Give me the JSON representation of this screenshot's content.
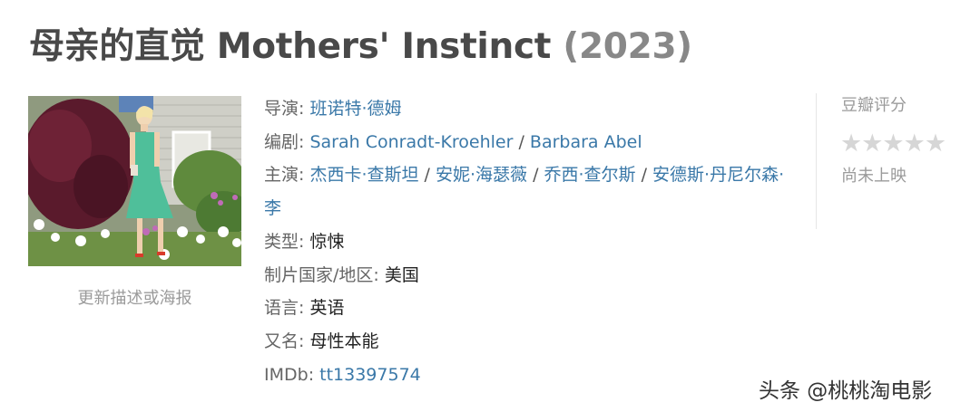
{
  "title": {
    "main": "母亲的直觉 Mothers' Instinct ",
    "year": "(2023)"
  },
  "poster": {
    "update_link": "更新描述或海报"
  },
  "info": {
    "director_label": "导演: ",
    "director": "班诺特·德姆",
    "writer_label": "编剧: ",
    "writers": [
      "Sarah Conradt-Kroehler",
      "Barbara Abel"
    ],
    "cast_label": "主演: ",
    "cast": [
      "杰西卡·查斯坦",
      "安妮·海瑟薇",
      "乔西·查尔斯",
      "安德斯·丹尼尔森·李"
    ],
    "separator": " / ",
    "genre_label": "类型: ",
    "genre": "惊悚",
    "country_label": "制片国家/地区: ",
    "country": "美国",
    "language_label": "语言: ",
    "language": "英语",
    "aka_label": "又名: ",
    "aka": "母性本能",
    "imdb_label": "IMDb: ",
    "imdb": "tt13397574"
  },
  "rating": {
    "label": "豆瓣评分",
    "stars": "★★★★★",
    "status": "尚未上映"
  },
  "watermark": "头条 @桃桃淘电影"
}
